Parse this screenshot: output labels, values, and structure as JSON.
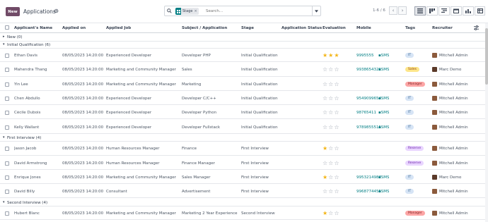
{
  "header": {
    "new_label": "New",
    "title": "Applications",
    "search_facet": "Stage",
    "search_placeholder": "Search...",
    "pager": "1-6 / 6"
  },
  "columns": [
    "Applicant's Name",
    "Applied on",
    "Applied Job",
    "Subject / Application",
    "Stage",
    "Application Status",
    "Evaluation",
    "Mobile",
    "Tags",
    "Recruiter"
  ],
  "groups": [
    {
      "label": "New (0)",
      "open": false
    },
    {
      "label": "Initial Qualification (6)",
      "open": true
    },
    {
      "label": "First Interview (4)",
      "open": true
    },
    {
      "label": "Second Interview (4)",
      "open": true
    }
  ],
  "rows": [
    {
      "name": "Ethan Davis",
      "applied": "08/05/2023 14:20:00",
      "job": "Experienced Developer",
      "subject": "Developer PHP",
      "stage": "Initial Qualification",
      "stars": 3,
      "mobile": "9995555",
      "sms": "SMS",
      "tag": "IT",
      "tag_color": "#d6e4f5",
      "tag_text": "#2f5d8a",
      "recruiter": "Mitchell Admin",
      "avatar": "#8b5a3c"
    },
    {
      "name": "Mahendra Thang",
      "applied": "08/05/2023 14:20:00",
      "job": "Marketing and Community Manager",
      "subject": "Sales",
      "stage": "Initial Qualification",
      "stars": 0,
      "mobile": "9938654321",
      "sms": "SMS",
      "tag": "Sales",
      "tag_color": "#fde68a",
      "tag_text": "#92400e",
      "recruiter": "Marc Demo",
      "avatar": "#5b3a29"
    },
    {
      "name": "Yin Lee",
      "applied": "08/05/2023 14:20:00",
      "job": "Marketing and Community Manager",
      "subject": "Marketing",
      "stage": "Initial Qualification",
      "stars": 0,
      "mobile": "",
      "sms": "",
      "tag": "Manager",
      "tag_color": "#fca5a5",
      "tag_text": "#7f1d1d",
      "recruiter": "Mitchell Admin",
      "avatar": "#8b5a3c"
    },
    {
      "name": "Chen Abdullo",
      "applied": "08/05/2023 14:20:00",
      "job": "Experienced Developer",
      "subject": "Developer C/C++",
      "stage": "Initial Qualification",
      "stars": 0,
      "mobile": "9549099654",
      "sms": "SMS",
      "tag": "IT",
      "tag_color": "#d6e4f5",
      "tag_text": "#2f5d8a",
      "recruiter": "Mitchell Admin",
      "avatar": "#8b5a3c"
    },
    {
      "name": "Cécile Dubois",
      "applied": "08/05/2023 14:20:00",
      "job": "Experienced Developer",
      "subject": "Developer Python",
      "stage": "Initial Qualification",
      "stars": 0,
      "mobile": "98765411",
      "sms": "SMS",
      "tag": "IT",
      "tag_color": "#d6e4f5",
      "tag_text": "#2f5d8a",
      "recruiter": "Mitchell Admin",
      "avatar": "#8b5a3c"
    },
    {
      "name": "Kelly Wallant",
      "applied": "08/05/2023 14:20:00",
      "job": "Experienced Developer",
      "subject": "Developer Fullstack",
      "stage": "Initial Qualification",
      "stars": 0,
      "mobile": "9789855515",
      "sms": "SMS",
      "tag": "IT",
      "tag_color": "#d6e4f5",
      "tag_text": "#2f5d8a",
      "recruiter": "Mitchell Admin",
      "avatar": "#8b5a3c"
    },
    {
      "name": "Jason Jacob",
      "applied": "08/05/2023 14:20:00",
      "job": "Human Resources Manager",
      "subject": "Finance",
      "stage": "First Interview",
      "stars": 1,
      "mobile": "",
      "sms": "",
      "tag": "Reserve",
      "tag_color": "#e9d5ff",
      "tag_text": "#6b21a8",
      "recruiter": "Mitchell Admin",
      "avatar": "#8b5a3c"
    },
    {
      "name": "David Armstrong",
      "applied": "08/05/2023 14:20:00",
      "job": "Human Resources Manager",
      "subject": "Finance Manager",
      "stage": "First Interview",
      "stars": 0,
      "mobile": "",
      "sms": "",
      "tag": "Reserve",
      "tag_color": "#e9d5ff",
      "tag_text": "#6b21a8",
      "recruiter": "Mitchell Admin",
      "avatar": "#8b5a3c"
    },
    {
      "name": "Enrique Jones",
      "applied": "08/05/2023 14:20:00",
      "job": "Marketing and Community Manager",
      "subject": "Sales Manager",
      "stage": "First Interview",
      "stars": 1,
      "mobile": "9953214987",
      "sms": "SMS",
      "tag": "IT",
      "tag_color": "#d6e4f5",
      "tag_text": "#2f5d8a",
      "recruiter": "Marc Demo",
      "avatar": "#5b3a29"
    },
    {
      "name": "David Billy",
      "applied": "08/05/2023 14:20:00",
      "job": "Consultant",
      "subject": "Advertisement",
      "stage": "First Interview",
      "stars": 0,
      "mobile": "9968774455",
      "sms": "SMS",
      "tag": "IT",
      "tag_color": "#d6e4f5",
      "tag_text": "#2f5d8a",
      "recruiter": "Mitchell Admin",
      "avatar": "#8b5a3c"
    },
    {
      "name": "Hubert Blanc",
      "applied": "08/05/2023 14:20:00",
      "job": "Marketing and Community Manager",
      "subject": "Marketing 2 Year Experience",
      "stage": "Second Interview",
      "stars": 1,
      "mobile": "",
      "sms": "",
      "tag": "Manager",
      "tag_color": "#fca5a5",
      "tag_text": "#7f1d1d",
      "recruiter": "Mitchell Admin",
      "avatar": "#8b5a3c"
    }
  ]
}
